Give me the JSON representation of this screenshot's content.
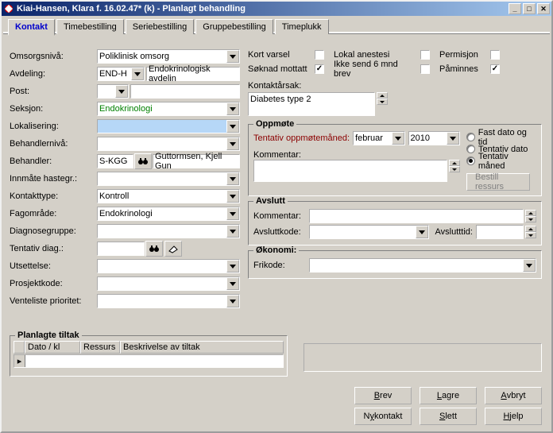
{
  "window": {
    "title": "Kiai-Hansen, Klara f. 16.02.47* (k) - Planlagt behandling"
  },
  "tabs": [
    "Kontakt",
    "Timebestilling",
    "Seriebestilling",
    "Gruppebestilling",
    "Timeplukk"
  ],
  "left": {
    "omsorgsniva": {
      "label": "Omsorgsnivå:",
      "value": "Poliklinisk omsorg"
    },
    "avdeling": {
      "label": "Avdeling:",
      "value": "END-H",
      "desc": "Endokrinologisk avdelin"
    },
    "post": {
      "label": "Post:",
      "value": "",
      "desc": ""
    },
    "seksjon": {
      "label": "Seksjon:",
      "value": "Endokrinologi"
    },
    "lokalisering": {
      "label": "Lokalisering:",
      "value": ""
    },
    "behandlerniva": {
      "label": "Behandlernivå:",
      "value": ""
    },
    "behandler": {
      "label": "Behandler:",
      "value": "S-KGG",
      "desc": "Guttormsen, Kjell Gun"
    },
    "innmate": {
      "label": "Innmåte hastegr.:",
      "value": ""
    },
    "kontakttype": {
      "label": "Kontakttype:",
      "value": "Kontroll"
    },
    "fagomrade": {
      "label": "Fagområde:",
      "value": "Endokrinologi"
    },
    "diagnosegruppe": {
      "label": "Diagnosegruppe:",
      "value": ""
    },
    "tentativdiag": {
      "label": "Tentativ diag.:",
      "value": ""
    },
    "utsettelse": {
      "label": "Utsettelse:",
      "value": ""
    },
    "prosjektkode": {
      "label": "Prosjektkode:",
      "value": ""
    },
    "venteliste": {
      "label": "Venteliste prioritet:",
      "value": ""
    }
  },
  "right": {
    "checks": {
      "kortvarsel": "Kort varsel",
      "lokalanestesi": "Lokal anestesi",
      "permisjon": "Permisjon",
      "soknad": "Søknad mottatt",
      "ikkesend": "Ikke send 6 mnd brev",
      "paminnes": "Påminnes"
    },
    "kontaktarsak": {
      "label": "Kontaktårsak:",
      "value": "Diabetes type 2"
    },
    "oppmote": {
      "legend": "Oppmøte",
      "tentativ_label": "Tentativ oppmøtemåned:",
      "month": "februar",
      "year": "2010",
      "radios": {
        "fast": "Fast dato og tid",
        "dato": "Tentativ dato",
        "maned": "Tentativ måned"
      },
      "kommentar_label": "Kommentar:",
      "bestill": "Bestill ressurs"
    },
    "avslutt": {
      "legend": "Avslutt",
      "kommentar_label": "Kommentar:",
      "avsluttkode_label": "Avsluttkode:",
      "avslutttid_label": "Avslutttid:"
    },
    "okonomi": {
      "legend": "Økonomi:",
      "frikode_label": "Frikode:"
    }
  },
  "grid": {
    "legend": "Planlagte tiltak",
    "cols": {
      "dato": "Dato / kl",
      "ressurs": "Ressurs",
      "beskrivelse": "Beskrivelse av tiltak"
    }
  },
  "buttons": {
    "brev": "Brev",
    "lagre": "Lagre",
    "avbryt": "Avbryt",
    "nykontakt": "Ny kontakt",
    "slett": "Slett",
    "hjelp": "Hjelp"
  }
}
